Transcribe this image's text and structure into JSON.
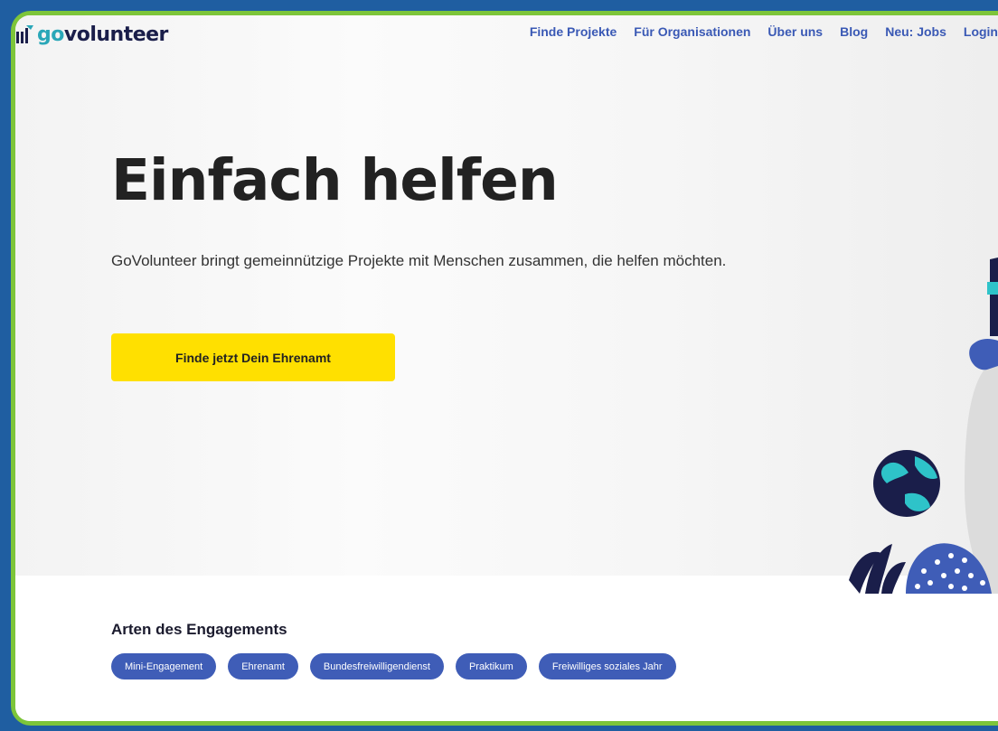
{
  "brand": {
    "name_prefix": "go",
    "name_suffix": "volunteer"
  },
  "nav": {
    "items": [
      "Finde Projekte",
      "Für Organisationen",
      "Über uns",
      "Blog",
      "Neu: Jobs",
      "Login"
    ]
  },
  "hero": {
    "headline": "Einfach helfen",
    "subtitle": "GoVolunteer bringt gemeinnützige Projekte mit Menschen zusammen, die helfen möchten.",
    "cta_label": "Finde jetzt Dein Ehrenamt"
  },
  "engagement": {
    "title": "Arten des Engagements",
    "tags": [
      "Mini-Engagement",
      "Ehrenamt",
      "Bundesfreiwilligendienst",
      "Praktikum",
      "Freiwilliges soziales Jahr"
    ]
  },
  "colors": {
    "accent": "#3f5db7",
    "cta": "#ffe000",
    "frame_green": "#7dc53a",
    "background_blue": "#1f5ea1"
  }
}
